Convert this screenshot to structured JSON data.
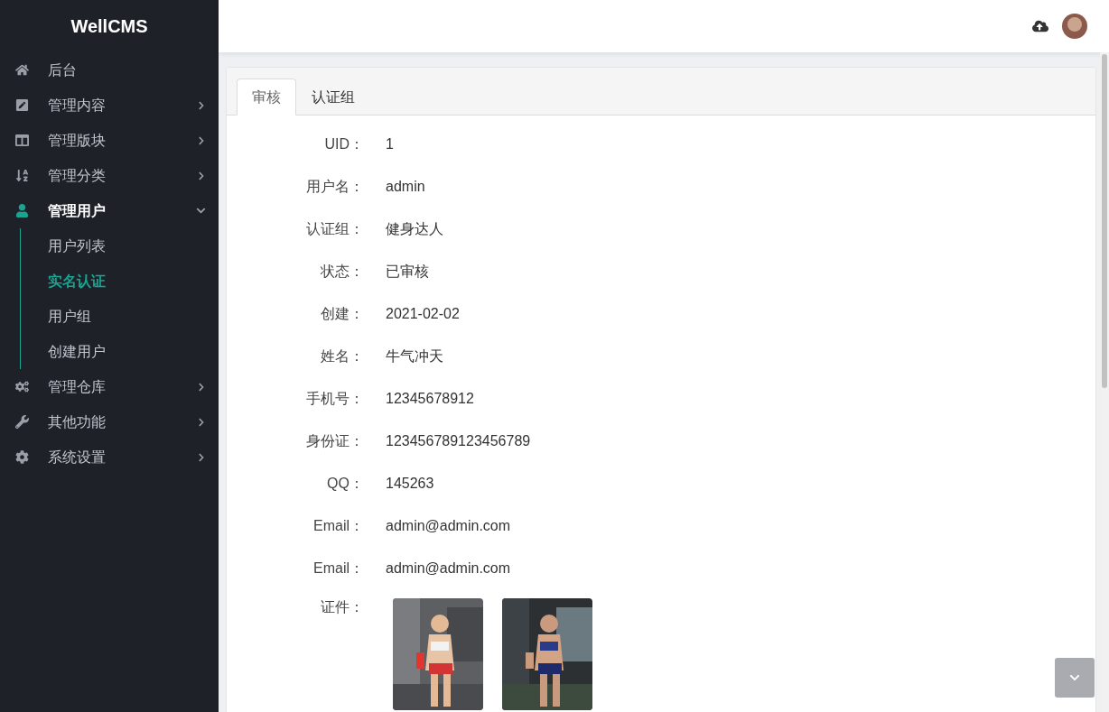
{
  "sidebar": {
    "brand": "WellCMS",
    "items": [
      {
        "label": "后台",
        "selected": false
      },
      {
        "label": "管理内容",
        "selected": false,
        "expanded": false
      },
      {
        "label": "管理版块",
        "selected": false,
        "expanded": false
      },
      {
        "label": "管理分类",
        "selected": false,
        "expanded": false
      },
      {
        "label": "管理用户",
        "selected": true,
        "expanded": true,
        "children": [
          {
            "label": "用户列表",
            "selected": false
          },
          {
            "label": "实名认证",
            "selected": true
          },
          {
            "label": "用户组",
            "selected": false
          },
          {
            "label": "创建用户",
            "selected": false
          }
        ]
      },
      {
        "label": "管理仓库",
        "selected": false,
        "expanded": false
      },
      {
        "label": "其他功能",
        "selected": false,
        "expanded": false
      },
      {
        "label": "系统设置",
        "selected": false,
        "expanded": false
      }
    ]
  },
  "tabs": [
    {
      "label": "审核",
      "selected": true
    },
    {
      "label": "认证组",
      "selected": false
    }
  ],
  "fields": [
    {
      "label": "UID：",
      "value": "1"
    },
    {
      "label": "用户名：",
      "value": "admin"
    },
    {
      "label": "认证组：",
      "value": "健身达人"
    },
    {
      "label": "状态：",
      "value": "已审核"
    },
    {
      "label": "创建：",
      "value": "2021-02-02"
    },
    {
      "label": "姓名：",
      "value": "牛气冲天"
    },
    {
      "label": "手机号：",
      "value": "12345678912"
    },
    {
      "label": "身份证：",
      "value": "123456789123456789"
    },
    {
      "label": "QQ：",
      "value": "145263"
    },
    {
      "label": "Email：",
      "value": "admin@admin.com"
    },
    {
      "label": "Email：",
      "value": "admin@admin.com"
    }
  ],
  "documents": {
    "label": "证件："
  }
}
